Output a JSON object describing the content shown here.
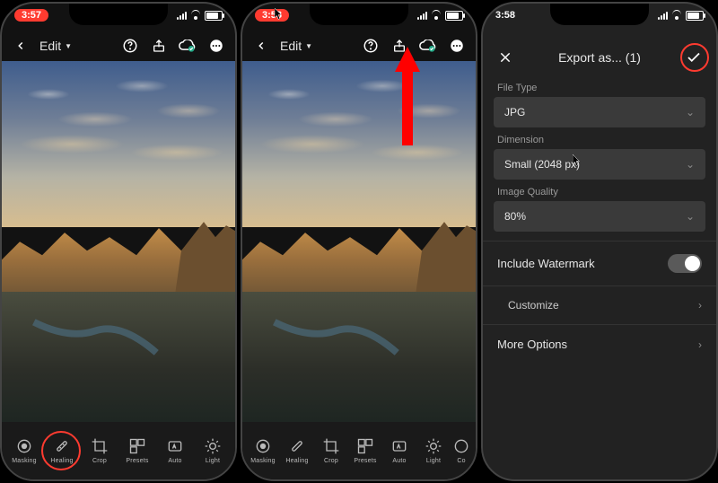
{
  "phone1": {
    "time": "3:57",
    "edit_label": "Edit",
    "tools": [
      {
        "label": "Masking"
      },
      {
        "label": "Healing"
      },
      {
        "label": "Crop"
      },
      {
        "label": "Presets"
      },
      {
        "label": "Auto"
      },
      {
        "label": "Light"
      }
    ]
  },
  "phone2": {
    "time": "3:58",
    "edit_label": "Edit",
    "tools": [
      {
        "label": "Masking"
      },
      {
        "label": "Healing"
      },
      {
        "label": "Crop"
      },
      {
        "label": "Presets"
      },
      {
        "label": "Auto"
      },
      {
        "label": "Light"
      },
      {
        "label": "Co"
      }
    ]
  },
  "phone3": {
    "time": "3:58",
    "title": "Export as... (1)",
    "file_type_label": "File Type",
    "file_type_value": "JPG",
    "dimension_label": "Dimension",
    "dimension_value": "Small (2048 px)",
    "quality_label": "Image Quality",
    "quality_value": "80%",
    "watermark_label": "Include Watermark",
    "customize_label": "Customize",
    "more_label": "More Options"
  },
  "icons": {
    "back": "chevron-left",
    "help": "help-circle",
    "share": "share",
    "cloud": "cloud-check",
    "more": "more-horizontal",
    "close": "x",
    "confirm": "check"
  }
}
